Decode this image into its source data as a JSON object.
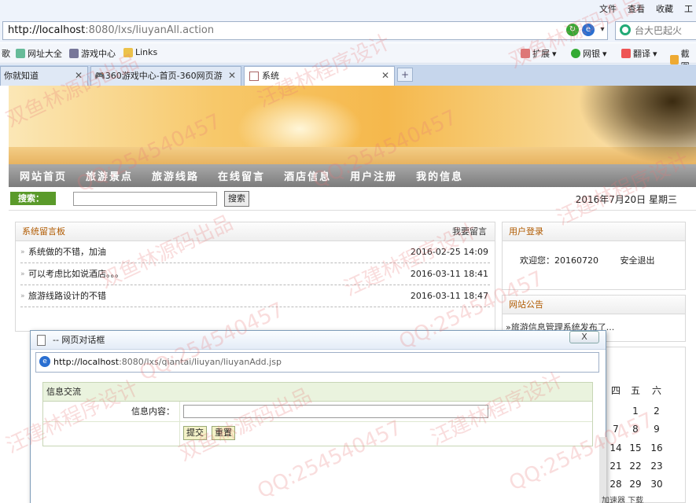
{
  "browser": {
    "menus": [
      "文件",
      "查看",
      "收藏",
      "工"
    ],
    "url_host": "http://localhost",
    "url_rest": ":8080/lxs/liuyanAll.action",
    "search_placeholder": "台大巴起火",
    "favorites": [
      "歌",
      "网址大全",
      "游戏中心",
      "Links"
    ],
    "tools": [
      "扩展",
      "网银",
      "翻译",
      "截图"
    ],
    "tabs": [
      {
        "label": "你就知道"
      },
      {
        "label": "360游戏中心-首页-360网页游"
      },
      {
        "label": "系统"
      }
    ]
  },
  "site": {
    "nav": [
      "网站首页",
      "旅游景点",
      "旅游线路",
      "在线留言",
      "酒店信息",
      "用户注册",
      "我的信息"
    ],
    "search_label": "搜索：",
    "search_button": "搜索",
    "date": "2016年7月20日 星期三"
  },
  "messages": {
    "title": "系统留言板",
    "action": "我要留言",
    "items": [
      {
        "text": "系统做的不错，加油",
        "time": "2016-02-25 14:09"
      },
      {
        "text": "可以考虑比如说酒店。。。",
        "time": "2016-03-11 18:41"
      },
      {
        "text": "旅游线路设计的不错",
        "time": "2016-03-11 18:47"
      }
    ]
  },
  "login": {
    "title": "用户登录",
    "welcome": "欢迎您：20160720",
    "logout": "安全退出"
  },
  "notice": {
    "title": "网站公告",
    "text": "»旅游信息管理系统发布了..."
  },
  "calendar": {
    "weekday_heads": [
      "四",
      "五",
      "六"
    ],
    "rows": [
      [
        "",
        "1",
        "2"
      ],
      [
        "7",
        "8",
        "9"
      ],
      [
        "14",
        "15",
        "16"
      ],
      [
        "21",
        "22",
        "23"
      ],
      [
        "28",
        "29",
        "30"
      ]
    ]
  },
  "dialog": {
    "title": "-- 网页对话框",
    "close": "X",
    "url_host": "http://localhost",
    "url_rest": ":8080/lxs/qiantai/liuyan/liuyanAdd.jsp",
    "form_title": "信息交流",
    "content_label": "信息内容：",
    "submit": "提交",
    "reset": "重置"
  },
  "status": {
    "text": "加速器  下载"
  },
  "watermarks": [
    "双鱼林源码出品",
    "QQ:254540457",
    "汪建林程序设计"
  ]
}
